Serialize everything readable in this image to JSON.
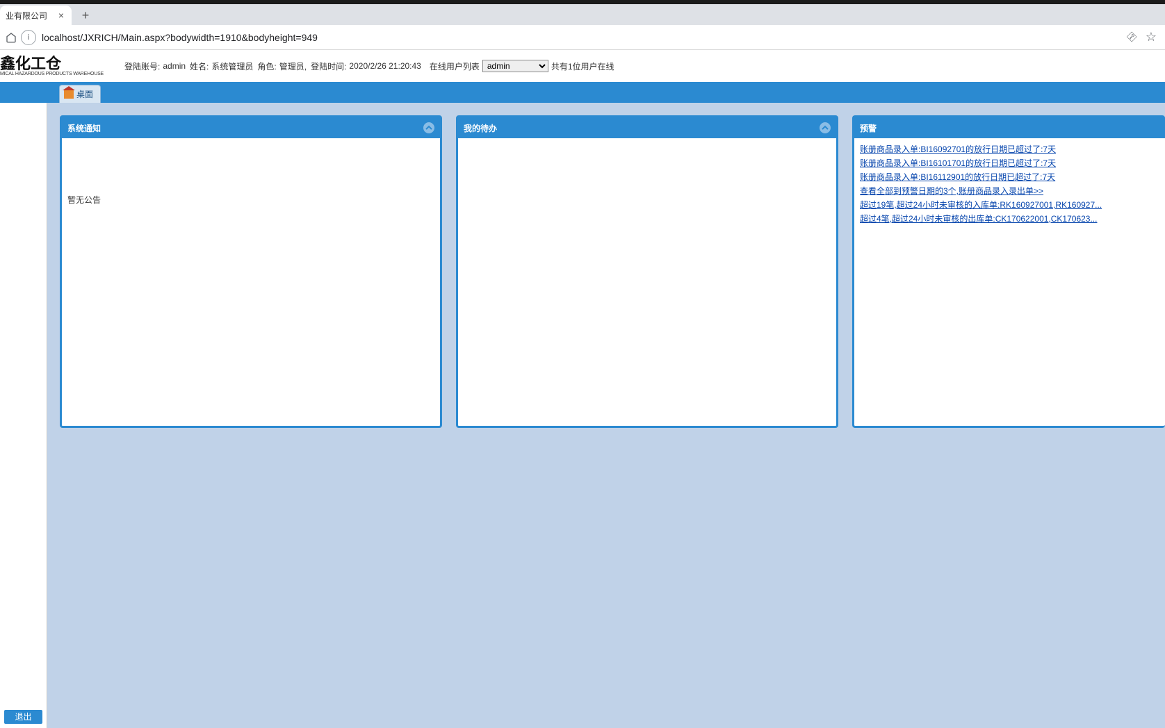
{
  "browser": {
    "tab_title": "业有限公司",
    "url": "localhost/JXRICH/Main.aspx?bodywidth=1910&bodyheight=949"
  },
  "logo": {
    "main": "鑫化工仓",
    "sub": "MICAL HAZARDOUS PRODUCTS WAREHOUSE"
  },
  "login": {
    "account_label": "登陆账号:",
    "account_value": "admin",
    "name_label": "姓名:",
    "name_value": "系统管理员",
    "role_label": "角色:",
    "role_value": "管理员,",
    "time_label": "登陆时间:",
    "time_value": "2020/2/26 21:20:43",
    "online_label": "在线用户列表",
    "online_selected": "admin",
    "online_count": "共有1位用户在线"
  },
  "nav": {
    "tab_desktop": "桌面"
  },
  "sidebar": {
    "logout": "退出"
  },
  "panels": {
    "notice_title": "系统通知",
    "notice_empty": "暂无公告",
    "todo_title": "我的待办",
    "alert_title": "预警"
  },
  "alerts": {
    "items": [
      "账册商品录入单:BI16092701的放行日期已超过了:7天",
      "账册商品录入单:BI16101701的放行日期已超过了:7天",
      "账册商品录入单:BI16112901的放行日期已超过了:7天"
    ],
    "line4a": "查看全部到预警日期的3个,",
    "line4b": "账册商品录入录出单>>",
    "line5": "超过19笔,超过24小时未审核的入库单:RK160927001,RK160927...",
    "line6": "超过4笔,超过24小时未审核的出库单:CK170622001,CK170623..."
  }
}
